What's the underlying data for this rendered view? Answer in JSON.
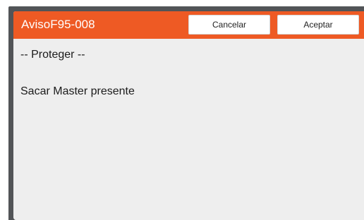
{
  "dialog": {
    "title": "AvisoF95-008",
    "buttons": {
      "cancel_label": "Cancelar",
      "accept_label": "Aceptar"
    },
    "message": {
      "heading": "-- Proteger --",
      "text": "Sacar Master presente"
    }
  },
  "colors": {
    "header": "#ee5a24",
    "body_background": "#eeeeee",
    "frame": "#525457",
    "button_background": "#ffffff"
  }
}
